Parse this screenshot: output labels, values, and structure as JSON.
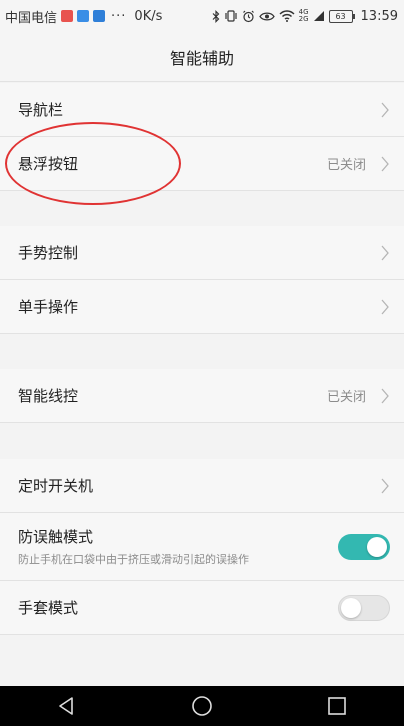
{
  "status_bar": {
    "carrier": "中国电信",
    "dots": "···",
    "net_speed": "0K/s",
    "signal_top": "4G",
    "signal_bottom": "2G",
    "battery": "63",
    "time": "13:59"
  },
  "title": "智能辅助",
  "groups": {
    "g1": {
      "nav_bar": {
        "label": "导航栏"
      },
      "floating_button": {
        "label": "悬浮按钮",
        "value": "已关闭"
      }
    },
    "g2": {
      "gesture_control": {
        "label": "手势控制"
      },
      "one_hand": {
        "label": "单手操作"
      }
    },
    "g3": {
      "smart_wire_control": {
        "label": "智能线控",
        "value": "已关闭"
      }
    },
    "g4": {
      "scheduled_power": {
        "label": "定时开关机"
      },
      "anti_mistouch": {
        "label": "防误触模式",
        "sub": "防止手机在口袋中由于挤压或滑动引起的误操作",
        "enabled": true
      },
      "glove_mode": {
        "label": "手套模式",
        "enabled": false
      }
    }
  },
  "colors": {
    "accent": "#33b8b1",
    "annotation": "#e03333"
  },
  "nav_icons": [
    "back-icon",
    "home-icon",
    "recents-icon"
  ]
}
